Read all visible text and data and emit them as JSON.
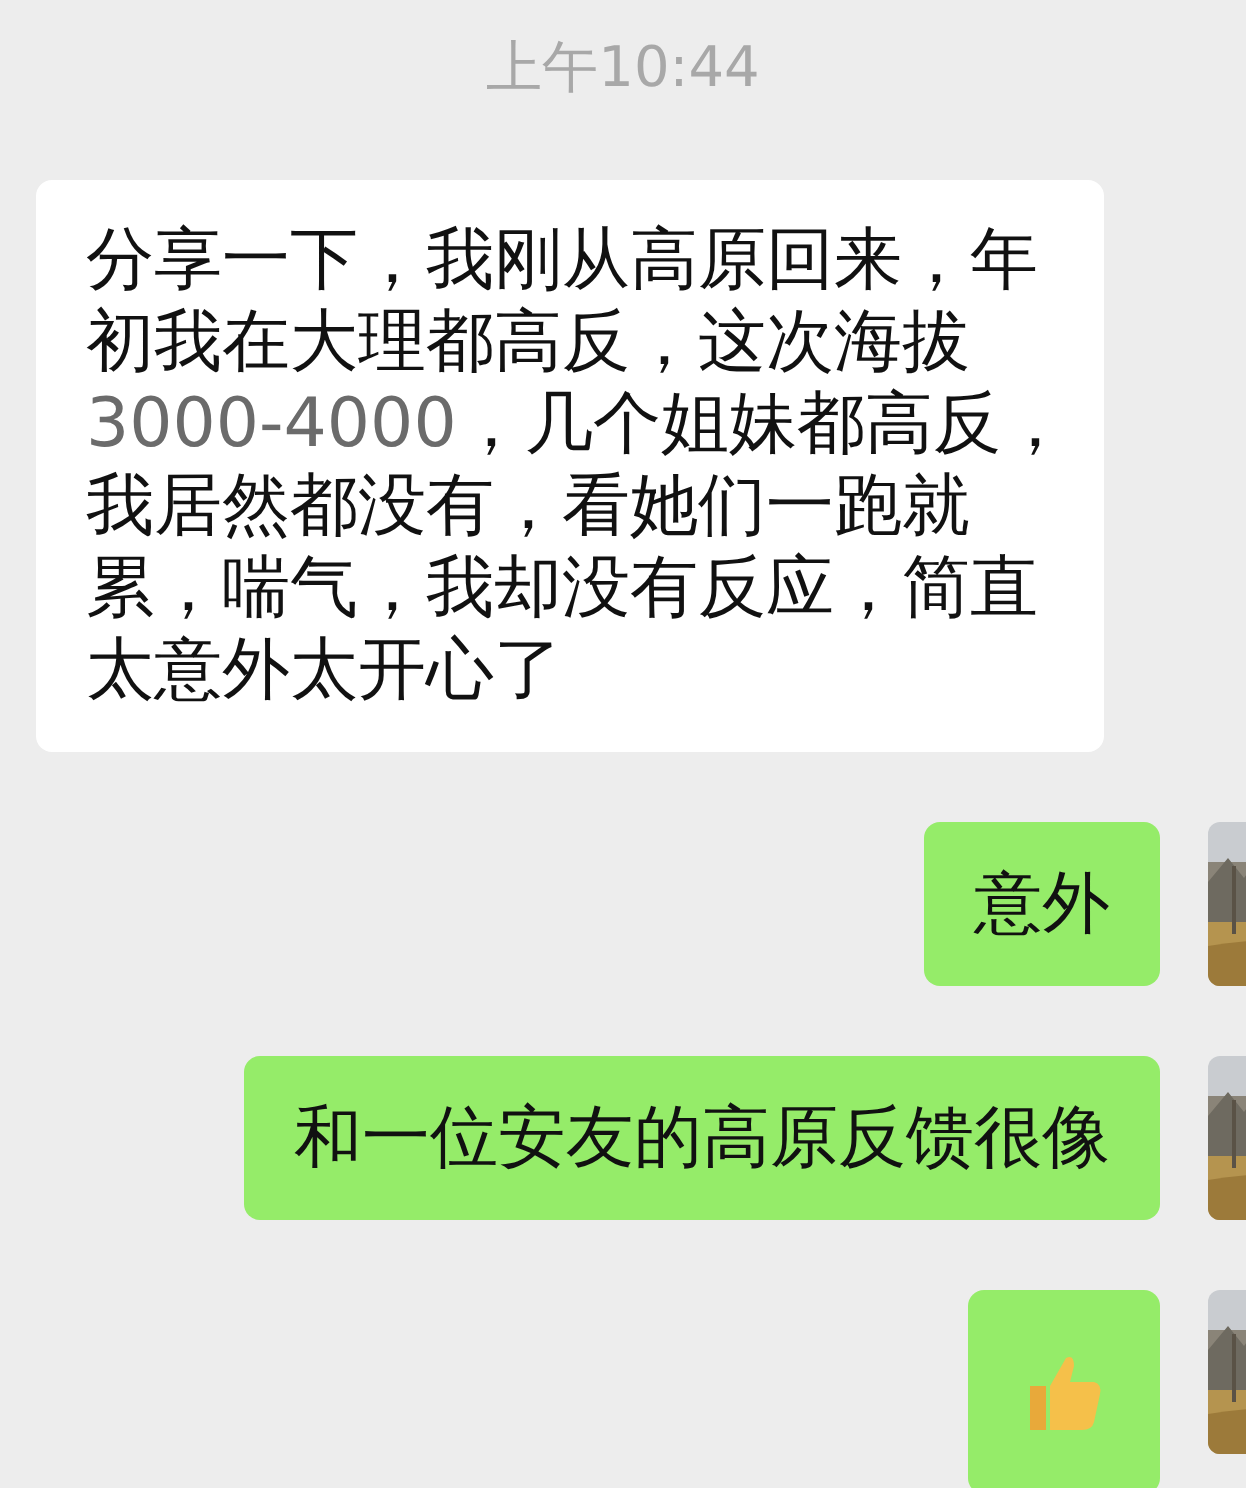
{
  "timestamp": "上午10:44",
  "messages": [
    {
      "sent": false,
      "kind": "text",
      "parts": [
        {
          "kind": "plain",
          "text": "分享一下，我刚从高原回来，年初我在大理都高反，这次海拔"
        },
        {
          "kind": "number",
          "text": "3000-4000"
        },
        {
          "kind": "plain",
          "text": "，几个姐妹都高反，我居然都没有，看她们一跑就累，喘气，我却没有反应，简直太意外太开心了"
        }
      ]
    },
    {
      "sent": true,
      "kind": "text",
      "parts": [
        {
          "kind": "plain",
          "text": "意外"
        }
      ]
    },
    {
      "sent": true,
      "kind": "text",
      "parts": [
        {
          "kind": "plain",
          "text": "和一位安友的高原反馈很像"
        }
      ]
    },
    {
      "sent": true,
      "kind": "thumbs_up"
    }
  ]
}
